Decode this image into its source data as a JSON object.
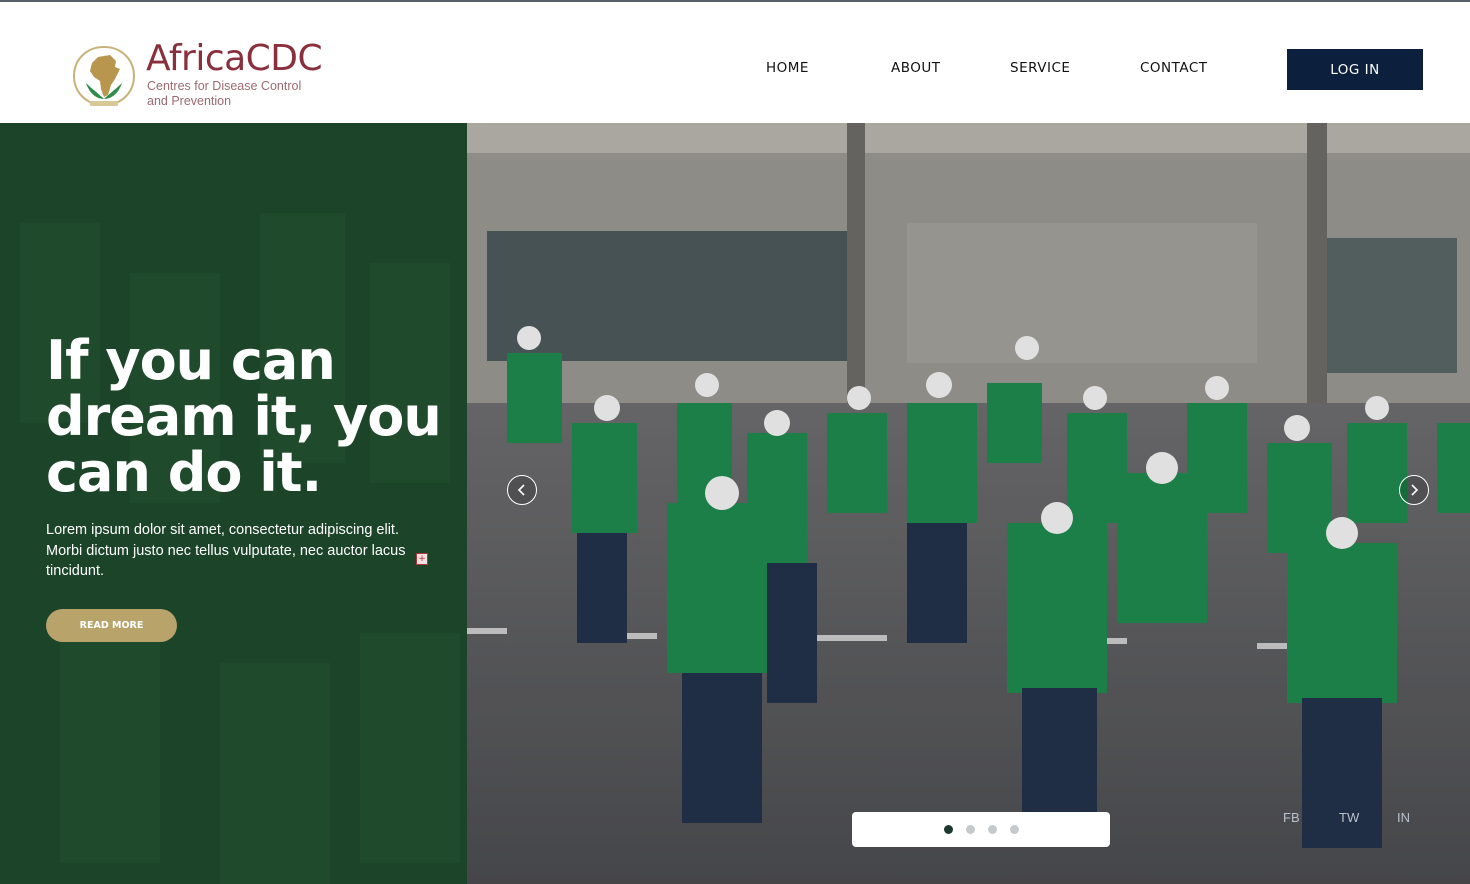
{
  "brand": {
    "name": "AfricaCDC",
    "subtitle_line1": "Centres for Disease Control",
    "subtitle_line2": "and Prevention",
    "emblem_icon": "africa-map-emblem-icon",
    "word_color": "#8a2f3c",
    "gold_color": "#b8a46b"
  },
  "nav": {
    "items": [
      {
        "label": "HOME"
      },
      {
        "label": "ABOUT"
      },
      {
        "label": "SERVICE"
      },
      {
        "label": "CONTACT"
      }
    ],
    "login_label": "LOG IN",
    "login_color": "#0c1f3d"
  },
  "hero": {
    "title_line1": "If you can",
    "title_line2": "dream it, you",
    "title_line3": "can do it.",
    "text": "Lorem ipsum dolor sit amet, consectetur adipiscing elit. Morbi dictum justo nec tellus vulputate, nec auctor lacus tincidunt.",
    "read_more": "READ MORE",
    "panel_color": "#1b4429",
    "photo_alt": "Group of health workers in green vests and face masks standing at an airport"
  },
  "slider": {
    "prev_icon": "chevron-left-icon",
    "next_icon": "chevron-right-icon",
    "slide_count": 4,
    "active_index": 0
  },
  "social": {
    "facebook": "FB",
    "twitter": "TW",
    "instagram": "IN"
  }
}
